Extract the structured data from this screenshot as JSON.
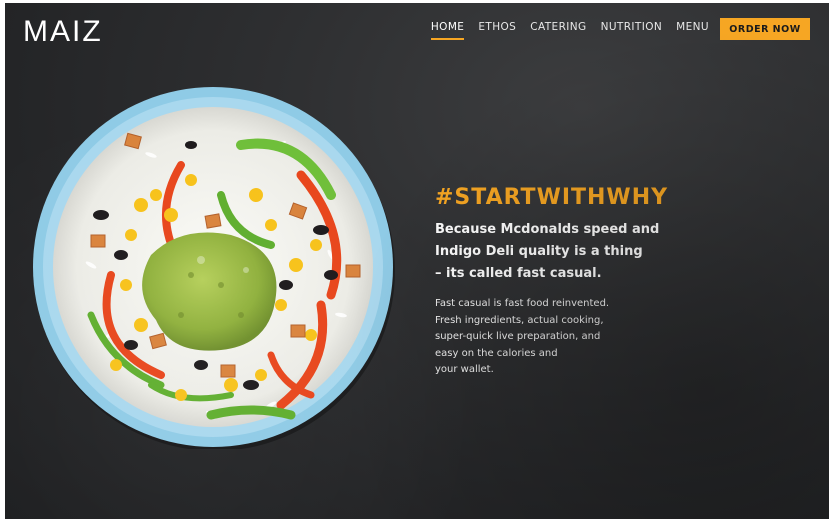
{
  "brand": {
    "logo_text": "MAIZ"
  },
  "nav": {
    "items": [
      {
        "label": "HOME",
        "active": true
      },
      {
        "label": "ETHOS",
        "active": false
      },
      {
        "label": "CATERING",
        "active": false
      },
      {
        "label": "NUTRITION",
        "active": false
      },
      {
        "label": "MENU",
        "active": false
      }
    ],
    "cta_label": "ORDER NOW"
  },
  "hero": {
    "hashtag": "#STARTWITHWHY",
    "lead_lines": [
      "Because Mcdonalds speed and",
      "Indigo Deli quality is a thing",
      "– its called fast casual."
    ],
    "body_lines": [
      "Fast casual is fast food reinvented.",
      "Fresh ingredients, actual cooking,",
      "super-quick live preparation, and",
      "easy on the calories and",
      "your wallet."
    ]
  },
  "colors": {
    "accent": "#f6a623",
    "background": "#2b2c2e",
    "bowl_rim": "#8fcbe6",
    "text": "#ffffff"
  },
  "images": {
    "hero_image": "burrito-bowl-image"
  }
}
